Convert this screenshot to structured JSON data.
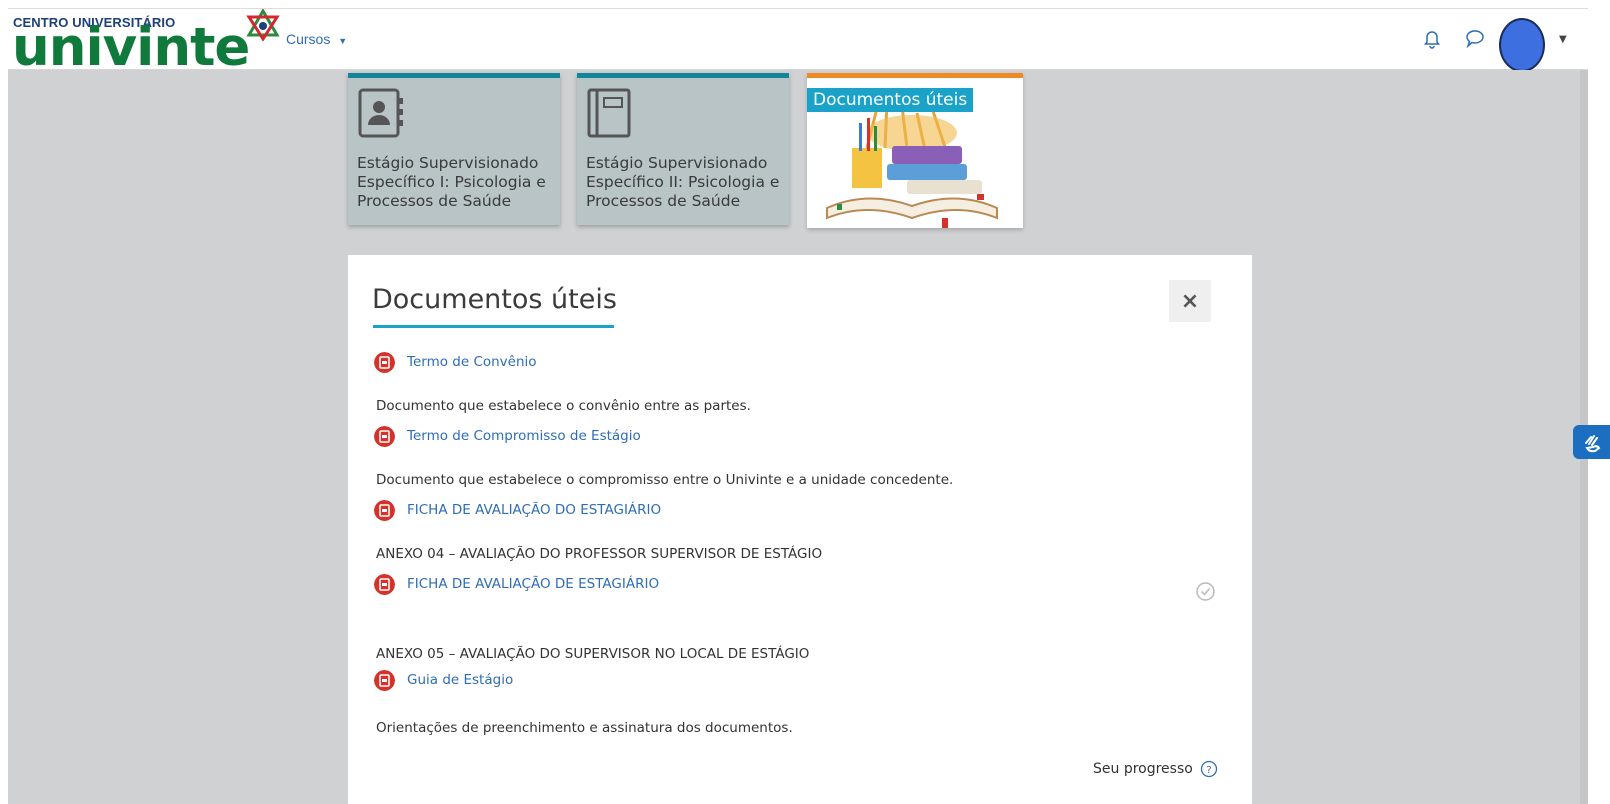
{
  "header": {
    "logo_small": "CENTRO UNIVERSITÁRIO",
    "logo_big": "univinte",
    "nav_cursos": "Cursos"
  },
  "tiles": [
    {
      "title": "Estágio Supervisionado Específico I: Psicologia e Processos de Saúde",
      "icon": "contact-book-icon"
    },
    {
      "title": "Estágio Supervisionado Específico II: Psicologia e Processos de Saúde",
      "icon": "notebook-icon"
    },
    {
      "title": "Documentos úteis",
      "icon": "books-illustration"
    }
  ],
  "modal": {
    "title": "Documentos úteis",
    "close_label": "×",
    "items": [
      {
        "link": "Termo de Convênio",
        "description": "Documento que estabelece o convênio entre as partes."
      },
      {
        "link": "Termo de Compromisso de Estágio",
        "description": "Documento que estabelece o compromisso entre o Univinte e a unidade concedente."
      },
      {
        "link": "FICHA DE AVALIAÇÃO DO ESTAGIÁRIO",
        "description": "ANEXO 04 – AVALIAÇÃO DO PROFESSOR SUPERVISOR DE ESTÁGIO"
      },
      {
        "link": "FICHA DE AVALIAÇÃO DE ESTAGIÁRIO",
        "description": "ANEXO 05 – AVALIAÇÃO DO SUPERVISOR NO LOCAL DE ESTÁGIO"
      },
      {
        "link": "Guia de Estágio",
        "description": "Orientações de preenchimento e assinatura dos documentos."
      }
    ],
    "progress_label": "Seu progresso"
  },
  "colors": {
    "link": "#2f6db5",
    "accent": "#1aa2c8",
    "pdf": "#d3332b",
    "tile_bg": "#b9c4c7",
    "content_bg": "#cfd1d2"
  }
}
